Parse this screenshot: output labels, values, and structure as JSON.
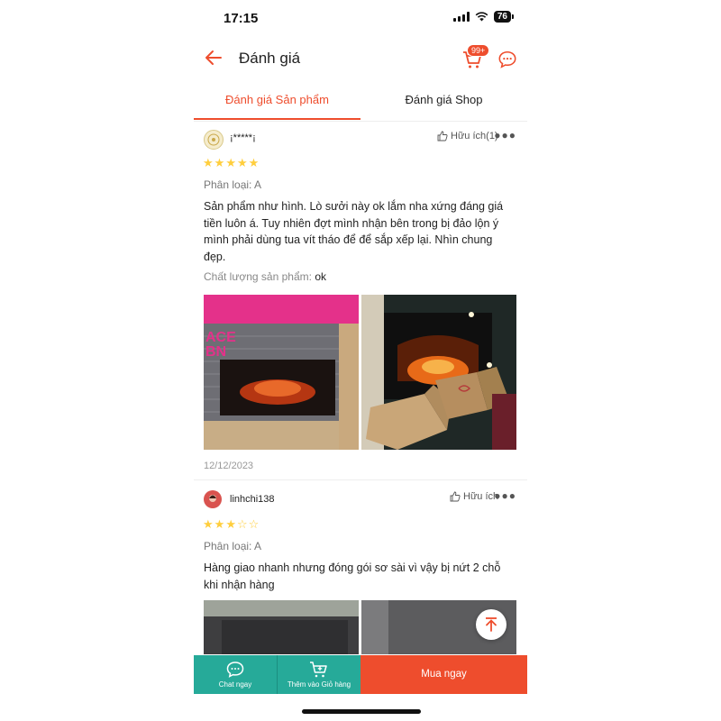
{
  "status_bar": {
    "time": "17:15",
    "battery": "76"
  },
  "header": {
    "title": "Đánh giá",
    "cart_badge": "99+"
  },
  "tabs": [
    {
      "label": "Đánh giá Sản phẩm"
    },
    {
      "label": "Đánh giá Shop"
    }
  ],
  "reviews": [
    {
      "user": "¡*****¡",
      "helpful": "Hữu ích(1)",
      "rating": 5,
      "variant": "Phân loại: A",
      "text": "Sản phẩm như hình. Lò sưởi này ok lắm nha xứng đáng giá tiền luôn á. Tuy nhiên đợt mình nhận bên trong bị đảo lộn ý mình phải dùng tua vít tháo để để sắp xếp lại. Nhìn chung đẹp.",
      "quality_label": "Chất lượng sản phẩm:",
      "quality_value": "ok",
      "box_text": "ACE\nBN",
      "date": "12/12/2023"
    },
    {
      "user": "linhchi138",
      "helpful": "Hữu ích",
      "rating": 3,
      "variant": "Phân loại: A",
      "text": "Hàng giao nhanh nhưng đóng gói sơ sài vì vậy bị nứt 2 chỗ khi nhận hàng"
    }
  ],
  "bottom_bar": {
    "chat": "Chat ngay",
    "add_cart": "Thêm vào Giỏ hàng",
    "buy": "Mua ngay"
  },
  "colors": {
    "accent": "#ee4d2d",
    "teal": "#26aa99",
    "star": "#ffce3d"
  },
  "icons": [
    "back-arrow-icon",
    "cart-icon",
    "chat-icon",
    "thumbs-up-icon",
    "more-icon",
    "star-icon",
    "scroll-top-icon",
    "add-cart-icon"
  ]
}
